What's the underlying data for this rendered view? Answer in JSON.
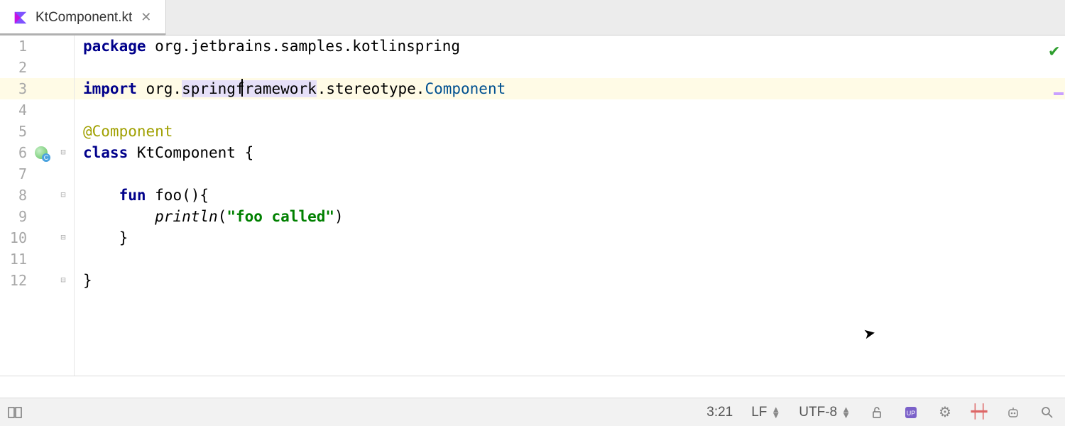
{
  "tab": {
    "filename": "KtComponent.kt",
    "icon": "kotlin-file-icon"
  },
  "editor": {
    "highlighted_line": 3,
    "caret": {
      "line": 3,
      "col": 21
    },
    "gutters": [
      {
        "n": 1,
        "fold": null,
        "icon": null
      },
      {
        "n": 2,
        "fold": null,
        "icon": null
      },
      {
        "n": 3,
        "fold": null,
        "icon": null
      },
      {
        "n": 4,
        "fold": null,
        "icon": null
      },
      {
        "n": 5,
        "fold": null,
        "icon": null
      },
      {
        "n": 6,
        "fold": "open",
        "icon": "spring-bean-icon"
      },
      {
        "n": 7,
        "fold": null,
        "icon": null
      },
      {
        "n": 8,
        "fold": "open",
        "icon": null
      },
      {
        "n": 9,
        "fold": null,
        "icon": null
      },
      {
        "n": 10,
        "fold": "close",
        "icon": null
      },
      {
        "n": 11,
        "fold": null,
        "icon": null
      },
      {
        "n": 12,
        "fold": "close",
        "icon": null
      }
    ],
    "lines": {
      "l1": {
        "kw": "package",
        "rest": " org.jetbrains.samples.kotlinspring"
      },
      "l2": {
        "text": ""
      },
      "l3": {
        "kw": "import",
        "pre": " org.",
        "hl": "springframework",
        "post": ".stereotype.",
        "type": "Component"
      },
      "l4": {
        "text": ""
      },
      "l5": {
        "ann": "@Component"
      },
      "l6": {
        "kw": "class",
        "rest": " KtComponent {"
      },
      "l7": {
        "text": ""
      },
      "l8": {
        "indent": "    ",
        "kw": "fun",
        "rest": " foo(){"
      },
      "l9": {
        "indent": "        ",
        "fn": "println",
        "open": "(",
        "str": "\"foo called\"",
        "close": ")"
      },
      "l10": {
        "text": "    }"
      },
      "l11": {
        "text": ""
      },
      "l12": {
        "text": "}"
      }
    },
    "inspection_status": "ok"
  },
  "statusbar": {
    "position": "3:21",
    "line_separator": "LF",
    "encoding": "UTF-8",
    "lock": "unlocked",
    "widgets": [
      "ide-update-icon",
      "settings-icon",
      "memory-indicator-icon",
      "ai-assistant-icon",
      "search-icon"
    ]
  },
  "colors": {
    "keyword": "#00008b",
    "string": "#008000",
    "annotation": "#a0a000",
    "type": "#005090",
    "highlight_bg": "#fffbe6",
    "identifier_bg": "#e6e0f8"
  }
}
